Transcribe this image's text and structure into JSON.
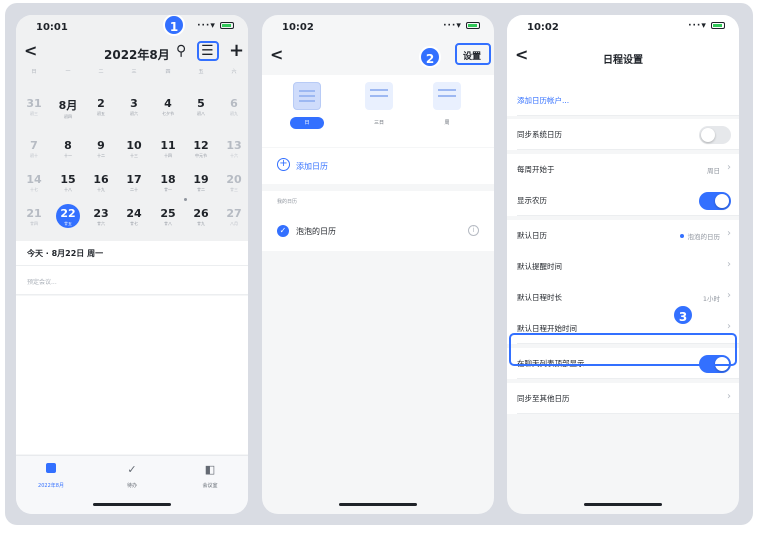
{
  "colors": {
    "accent": "#3370ff",
    "background": "#d9dce3"
  },
  "screen1": {
    "time": "10:01",
    "title": "2022年8月",
    "badge": "1",
    "weekdays": [
      "日",
      "一",
      "二",
      "三",
      "四",
      "五",
      "六"
    ],
    "weeks": [
      [
        {
          "n": "31",
          "l": "初三",
          "dim": true
        },
        {
          "n": "8月",
          "l": "初四"
        },
        {
          "n": "2",
          "l": "初五"
        },
        {
          "n": "3",
          "l": "初六"
        },
        {
          "n": "4",
          "l": "七夕节"
        },
        {
          "n": "5",
          "l": "初八"
        },
        {
          "n": "6",
          "l": "初九",
          "dim": true
        }
      ],
      [
        {
          "n": "7",
          "l": "初十",
          "dim": true
        },
        {
          "n": "8",
          "l": "十一"
        },
        {
          "n": "9",
          "l": "十二"
        },
        {
          "n": "10",
          "l": "十三"
        },
        {
          "n": "11",
          "l": "十四"
        },
        {
          "n": "12",
          "l": "中元节"
        },
        {
          "n": "13",
          "l": "十六",
          "dim": true
        }
      ],
      [
        {
          "n": "14",
          "l": "十七",
          "dim": true
        },
        {
          "n": "15",
          "l": "十八"
        },
        {
          "n": "16",
          "l": "十九"
        },
        {
          "n": "17",
          "l": "二十"
        },
        {
          "n": "18",
          "l": "廿一"
        },
        {
          "n": "19",
          "l": "廿二"
        },
        {
          "n": "20",
          "l": "廿三",
          "dim": true
        }
      ],
      [
        {
          "n": "21",
          "l": "廿四",
          "dim": true
        },
        {
          "n": "22",
          "l": "廿五",
          "sel": true
        },
        {
          "n": "23",
          "l": "廿六"
        },
        {
          "n": "24",
          "l": "廿七"
        },
        {
          "n": "25",
          "l": "廿八"
        },
        {
          "n": "26",
          "l": "廿九"
        },
        {
          "n": "27",
          "l": "八月",
          "dim": true
        }
      ]
    ],
    "today_line": "今天 · 8月22日 周一",
    "meeting_placeholder": "预定会议...",
    "tabs": [
      {
        "label": "2022年8月"
      },
      {
        "label": "待办"
      },
      {
        "label": "会议室"
      }
    ]
  },
  "screen2": {
    "time": "10:02",
    "badge": "2",
    "settings_label": "设置",
    "views": [
      {
        "label": "日"
      },
      {
        "label": "三日"
      },
      {
        "label": "周"
      }
    ],
    "add_calendar": "添加日历",
    "my_calendars_header": "我的日历",
    "calendar_name": "泡泡的日历"
  },
  "screen3": {
    "time": "10:02",
    "badge": "3",
    "title": "日程设置",
    "rows": [
      {
        "label": "添加日历帐户..."
      },
      {
        "label": "同步系统日历",
        "toggle": false
      },
      {
        "label": "每周开始于",
        "value": "周日"
      },
      {
        "label": "显示农历",
        "toggle": true
      },
      {
        "label": "默认日历",
        "value": "泡泡的日历"
      },
      {
        "label": "默认提醒时间"
      },
      {
        "label": "默认日程时长",
        "value": "1小时"
      },
      {
        "label": "默认日程开始时间"
      },
      {
        "label": "在聊天列表顶部显示",
        "toggle": true
      },
      {
        "label": "同步至其他日历"
      }
    ]
  }
}
